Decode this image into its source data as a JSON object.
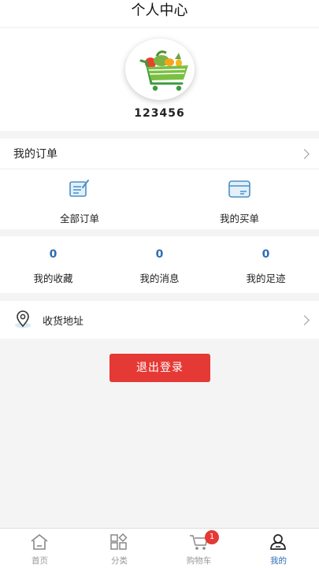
{
  "header": {
    "title": "个人中心"
  },
  "profile": {
    "username": "123456"
  },
  "orders": {
    "title": "我的订单",
    "items": [
      {
        "label": "全部订单",
        "icon": "document-edit-icon"
      },
      {
        "label": "我的买单",
        "icon": "card-icon"
      }
    ]
  },
  "stats": [
    {
      "value": "0",
      "label": "我的收藏"
    },
    {
      "value": "0",
      "label": "我的消息"
    },
    {
      "value": "0",
      "label": "我的足迹"
    }
  ],
  "address": {
    "label": "收货地址",
    "icon": "location-pin-icon"
  },
  "logout": {
    "label": "退出登录"
  },
  "tabbar": {
    "tabs": [
      {
        "label": "首页",
        "icon": "home-icon"
      },
      {
        "label": "分类",
        "icon": "category-icon"
      },
      {
        "label": "购物车",
        "icon": "cart-icon",
        "badge": "1"
      },
      {
        "label": "我的",
        "icon": "user-icon",
        "active": true
      }
    ]
  },
  "colors": {
    "accent": "#2f6db3",
    "danger": "#e53935",
    "icon_blue": "#4a90c8"
  }
}
